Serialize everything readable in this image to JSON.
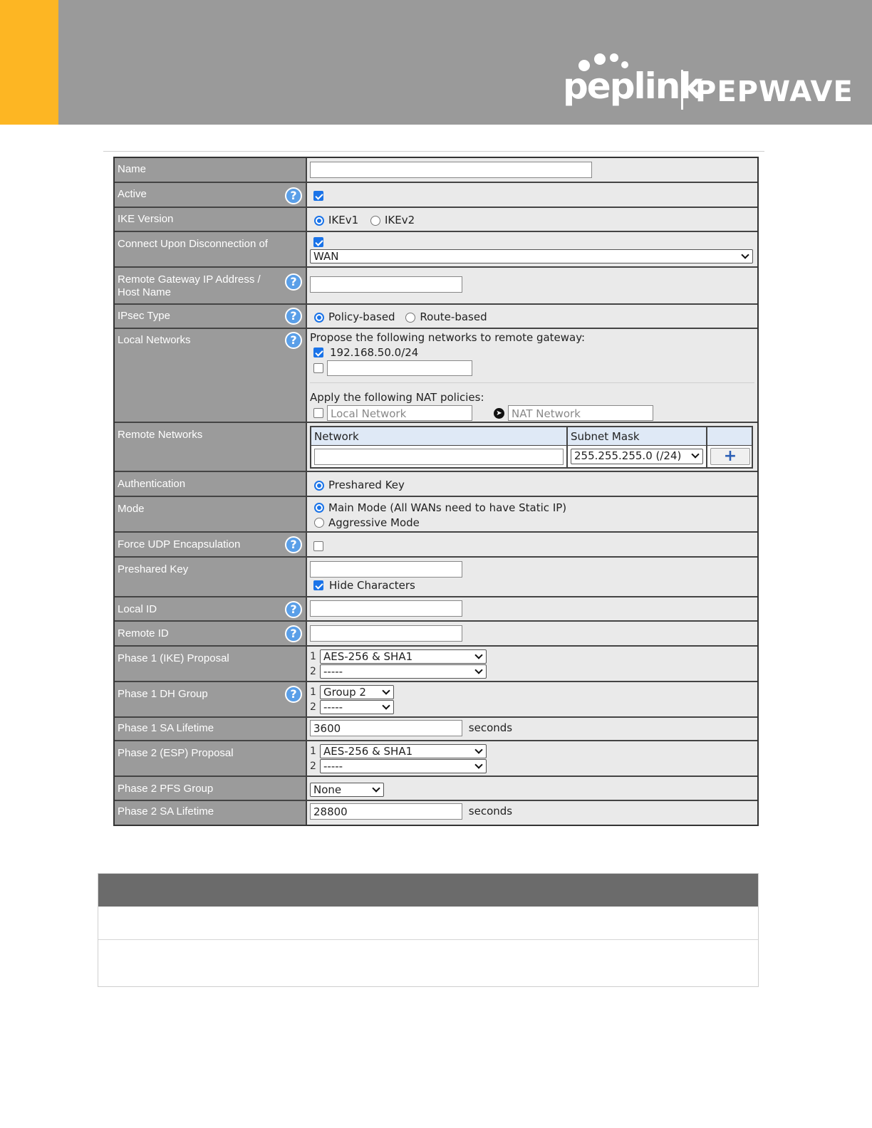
{
  "brand": {
    "logo_primary": "peplink",
    "logo_secondary": "PEPWAVE",
    "accent_color": "#fdb623",
    "header_color": "#9a9a9a"
  },
  "form": {
    "name": {
      "label": "Name",
      "value": ""
    },
    "active": {
      "label": "Active",
      "checked": true
    },
    "ike_version": {
      "label": "IKE Version",
      "options": [
        "IKEv1",
        "IKEv2"
      ],
      "selected": "IKEv1"
    },
    "connect_upon": {
      "label": "Connect Upon Disconnection of",
      "checked": true,
      "select": "WAN"
    },
    "remote_gateway": {
      "label": "Remote Gateway IP Address / Host Name",
      "value": ""
    },
    "ipsec_type": {
      "label": "IPsec Type",
      "options": [
        "Policy-based",
        "Route-based"
      ],
      "selected": "Policy-based"
    },
    "local_networks": {
      "label": "Local Networks",
      "propose_text": "Propose the following networks to remote gateway:",
      "network1": "192.168.50.0/24",
      "network1_checked": true,
      "nat_text": "Apply the following NAT policies:",
      "local_network_placeholder": "Local Network",
      "nat_network_placeholder": "NAT Network"
    },
    "remote_networks": {
      "label": "Remote Networks",
      "col_network": "Network",
      "col_subnet": "Subnet Mask",
      "subnet_value": "255.255.255.0 (/24)",
      "add_label": "+"
    },
    "authentication": {
      "label": "Authentication",
      "option": "Preshared Key"
    },
    "mode": {
      "label": "Mode",
      "option1": "Main Mode (All WANs need to have Static IP)",
      "option2": "Aggressive Mode",
      "selected": "Main Mode"
    },
    "force_udp": {
      "label": "Force UDP Encapsulation",
      "checked": false
    },
    "preshared_key": {
      "label": "Preshared Key",
      "value": "",
      "hide_label": "Hide Characters",
      "hide_checked": true
    },
    "local_id": {
      "label": "Local ID",
      "value": ""
    },
    "remote_id": {
      "label": "Remote ID",
      "value": ""
    },
    "phase1_proposal": {
      "label": "Phase 1 (IKE) Proposal",
      "idx1": "1",
      "idx2": "2",
      "sel1": "AES-256 & SHA1",
      "sel2": "-----"
    },
    "phase1_dh": {
      "label": "Phase 1 DH Group",
      "idx1": "1",
      "idx2": "2",
      "sel1": "Group 2",
      "sel2": "-----"
    },
    "phase1_sa": {
      "label": "Phase 1 SA Lifetime",
      "value": "3600",
      "unit": "seconds"
    },
    "phase2_proposal": {
      "label": "Phase 2 (ESP) Proposal",
      "idx1": "1",
      "idx2": "2",
      "sel1": "AES-256 & SHA1",
      "sel2": "-----"
    },
    "phase2_pfs": {
      "label": "Phase 2 PFS Group",
      "select": "None"
    },
    "phase2_sa": {
      "label": "Phase 2 SA Lifetime",
      "value": "28800",
      "unit": "seconds"
    }
  },
  "icons": {
    "help": "question-mark-icon",
    "help_glyph": "?",
    "nat_arrow": "arrow-right-circle-icon"
  }
}
